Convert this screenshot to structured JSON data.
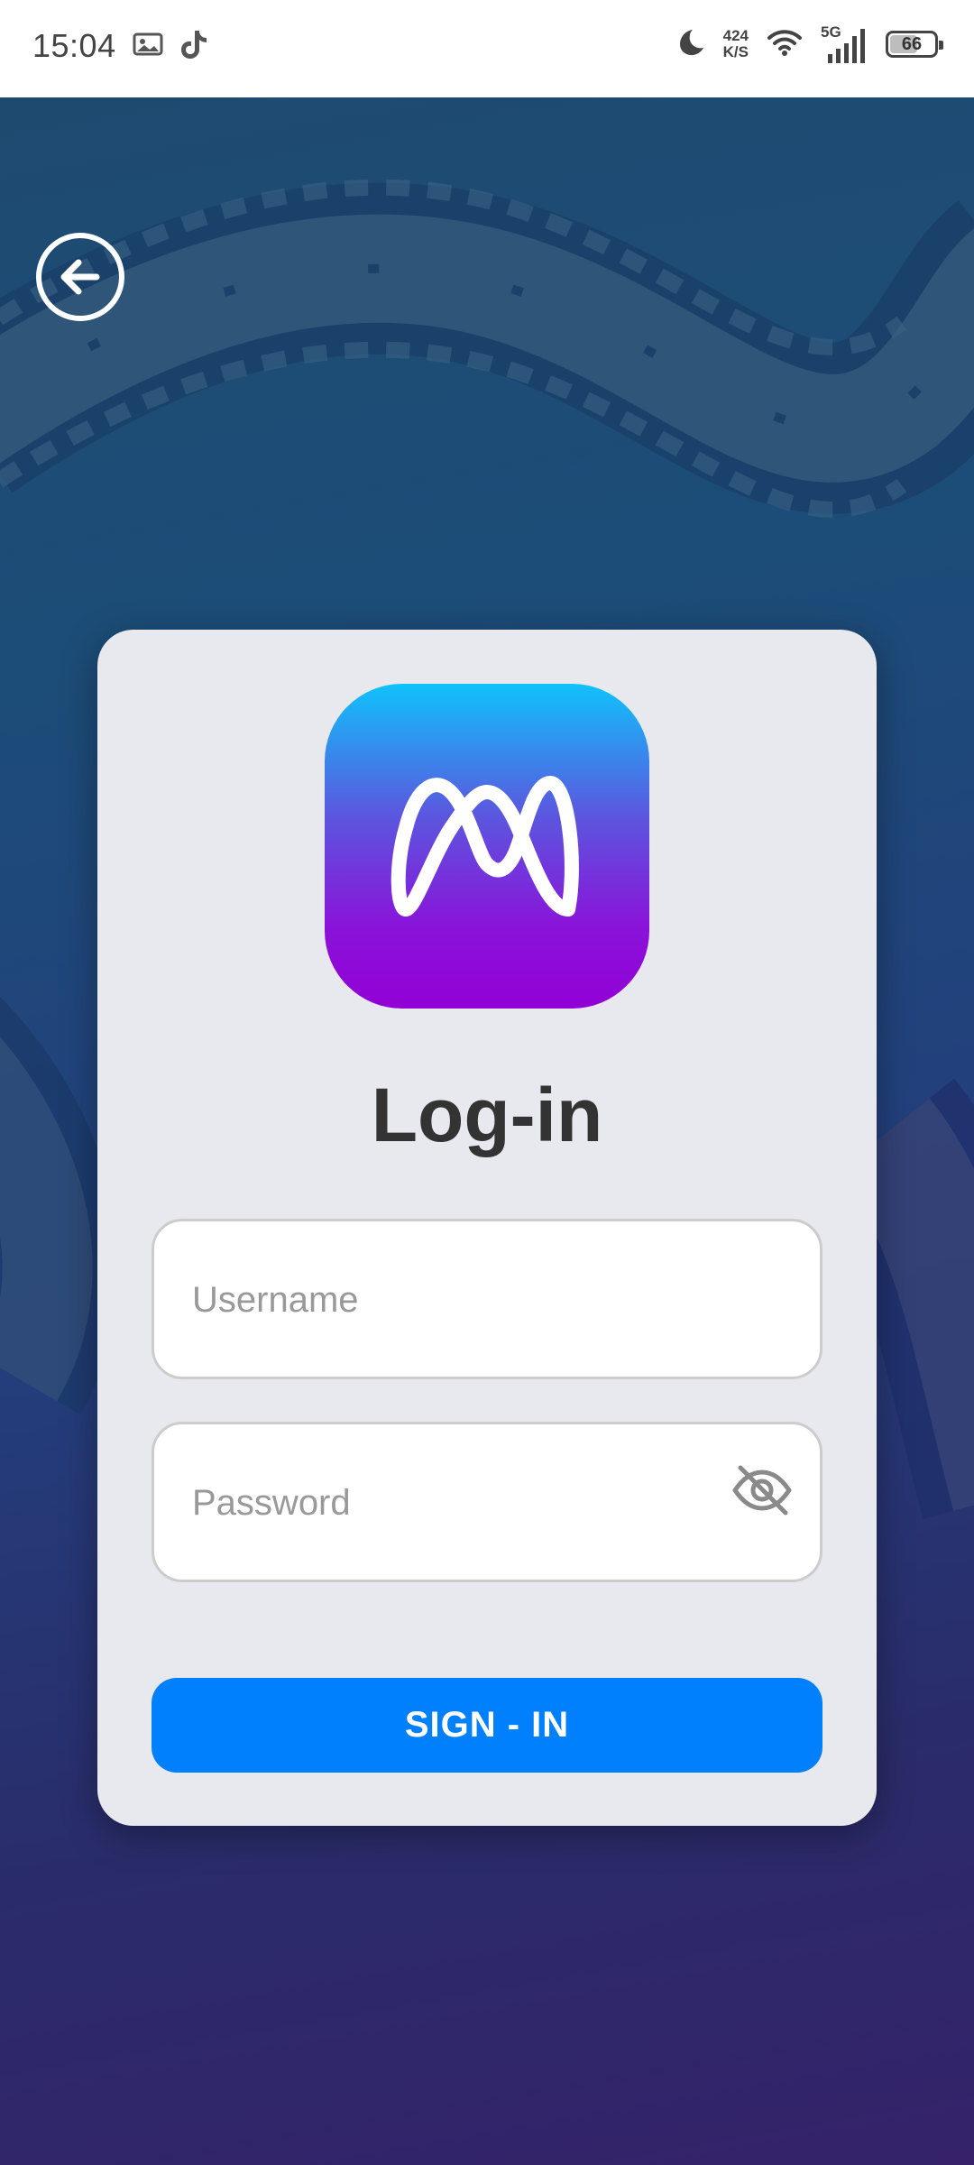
{
  "status_bar": {
    "time": "15:04",
    "speed_value": "424",
    "speed_unit": "K/S",
    "network": "5G",
    "battery": "66",
    "battery_level": 0.66,
    "icons": [
      "gallery-icon",
      "tiktok-icon",
      "moon-icon",
      "wifi-icon",
      "signal-icon",
      "battery-icon"
    ]
  },
  "navigation": {
    "back_icon": "arrow-left-circle-icon"
  },
  "login": {
    "logo_icon": "app-logo-icon",
    "title": "Log-in",
    "username_placeholder": "Username",
    "username_value": "",
    "password_placeholder": "Password",
    "password_value": "",
    "password_toggle_icon": "eye-off-icon",
    "submit_label": "SIGN - IN"
  },
  "colors": {
    "button": "#0080fc",
    "card": "#e8e9ee",
    "logo_top": "#10c2fb",
    "logo_bottom": "#9200d6",
    "background_top": "#1f4a70",
    "background_bottom": "#35226a"
  }
}
